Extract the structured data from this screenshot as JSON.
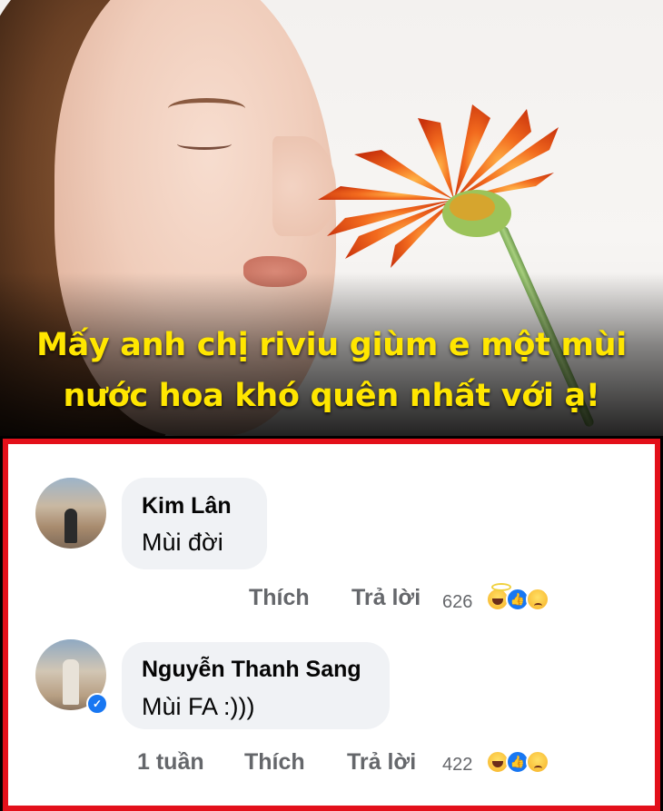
{
  "headline": {
    "line1": "Mấy anh chị riviu giùm e một mùi",
    "line2": "nước hoa khó quên nhất với ạ!"
  },
  "colors": {
    "headline": "#ffe600",
    "panel_border": "#e3101a",
    "bubble": "#f0f2f5",
    "meta_text": "#65676b",
    "like_blue": "#1877f2"
  },
  "comments": [
    {
      "author": "Kim Lân",
      "text": "Mùi đời",
      "time": "",
      "like_label": "Thích",
      "reply_label": "Trả lời",
      "reaction_count": "626",
      "reactions": [
        "haha-icon",
        "like-icon",
        "sad-icon"
      ]
    },
    {
      "author": "Nguyễn Thanh Sang",
      "text": "Mùi FA :)))",
      "time": "1 tuần",
      "like_label": "Thích",
      "reply_label": "Trả lời",
      "reaction_count": "422",
      "reactions": [
        "haha-icon",
        "like-icon",
        "sad-icon"
      ],
      "verified": true
    }
  ]
}
